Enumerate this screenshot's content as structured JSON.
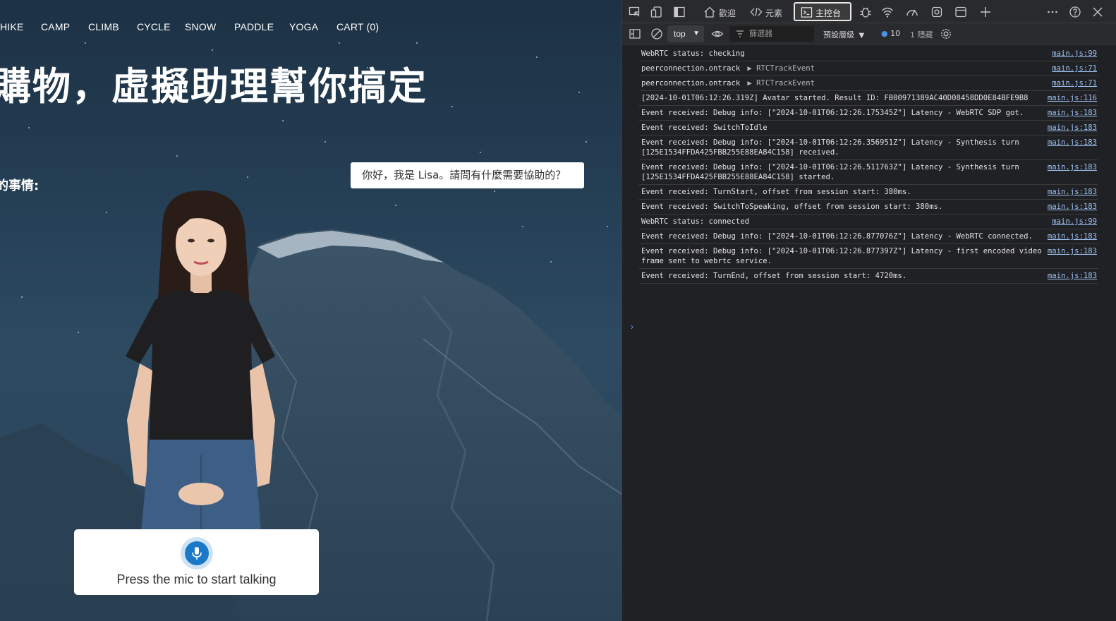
{
  "site": {
    "nav": [
      "HIKE",
      "CAMP",
      "CLIMB",
      "CYCLE",
      "SNOW",
      "PADDLE",
      "YOGA",
      "CART (0)"
    ],
    "hero_title": "購物，虛擬助理幫你搞定",
    "subheading": "的事情:",
    "assistant_bubble": "你好，我是 Lisa。請問有什麼需要協助的？",
    "mic_label": "Press the mic to start talking"
  },
  "devtools": {
    "tabs": {
      "welcome": "歡迎",
      "elements": "元素",
      "console": "主控台"
    },
    "context": "top",
    "filter_placeholder": "篩選器",
    "levels": "預設層級",
    "issue_count": "10",
    "hidden": "1 隱藏",
    "prompt_symbol": "›",
    "logs": [
      {
        "text": "WebRTC status: checking",
        "source": "main.js:99"
      },
      {
        "text": "peerconnection.ontrack",
        "object": "▶ RTCTrackEvent",
        "source": "main.js:71"
      },
      {
        "text": "peerconnection.ontrack",
        "object": "▶ RTCTrackEvent",
        "source": "main.js:71"
      },
      {
        "text": "[2024-10-01T06:12:26.319Z] Avatar started. Result ID: FB00971389AC40D08458DD0E84BFE9B8",
        "source": "main.js:116"
      },
      {
        "text": "Event received: Debug info: [\"2024-10-01T06:12:26.175345Z\"] Latency - WebRTC SDP got.",
        "source": "main.js:183"
      },
      {
        "text": "Event received: SwitchToIdle",
        "source": "main.js:183"
      },
      {
        "text": "Event received: Debug info: [\"2024-10-01T06:12:26.356951Z\"] Latency - Synthesis turn [125E1534FFDA425FBB255E88EA84C158] received.",
        "source": "main.js:183"
      },
      {
        "text": "Event received: Debug info: [\"2024-10-01T06:12:26.511763Z\"] Latency - Synthesis turn [125E1534FFDA425FBB255E88EA84C158] started.",
        "source": "main.js:183"
      },
      {
        "text": "Event received: TurnStart, offset from session start: 380ms.",
        "source": "main.js:183"
      },
      {
        "text": "Event received: SwitchToSpeaking, offset from session start: 380ms.",
        "source": "main.js:183"
      },
      {
        "text": "WebRTC status: connected",
        "source": "main.js:99"
      },
      {
        "text": "Event received: Debug info: [\"2024-10-01T06:12:26.877076Z\"] Latency - WebRTC connected.",
        "source": "main.js:183"
      },
      {
        "text": "Event received: Debug info: [\"2024-10-01T06:12:26.877397Z\"] Latency - first encoded video frame sent to webrtc service.",
        "source": "main.js:183"
      },
      {
        "text": "Event received: TurnEnd, offset from session start: 4720ms.",
        "source": "main.js:183"
      }
    ]
  }
}
